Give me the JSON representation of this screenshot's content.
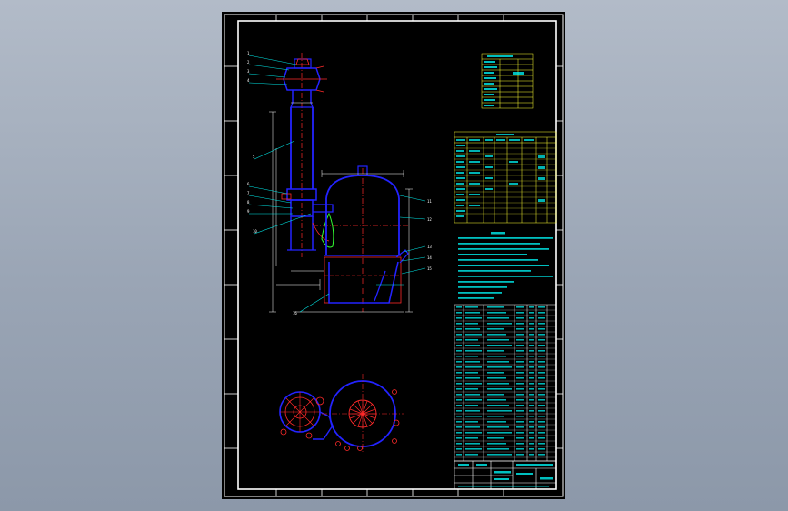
{
  "colors": {
    "background": "#9aa5b5",
    "sheet": "#000000",
    "frame": "#ffffff",
    "outline": "#2323ff",
    "centerline": "#ff2a2a",
    "dimension": "#ffffff",
    "leader": "#00e5e5",
    "table_grid": "#ffff33",
    "table_text": "#00ffff",
    "hatch": "#33ff33"
  },
  "icons": {
    "zoom": "magnifier-icon"
  }
}
